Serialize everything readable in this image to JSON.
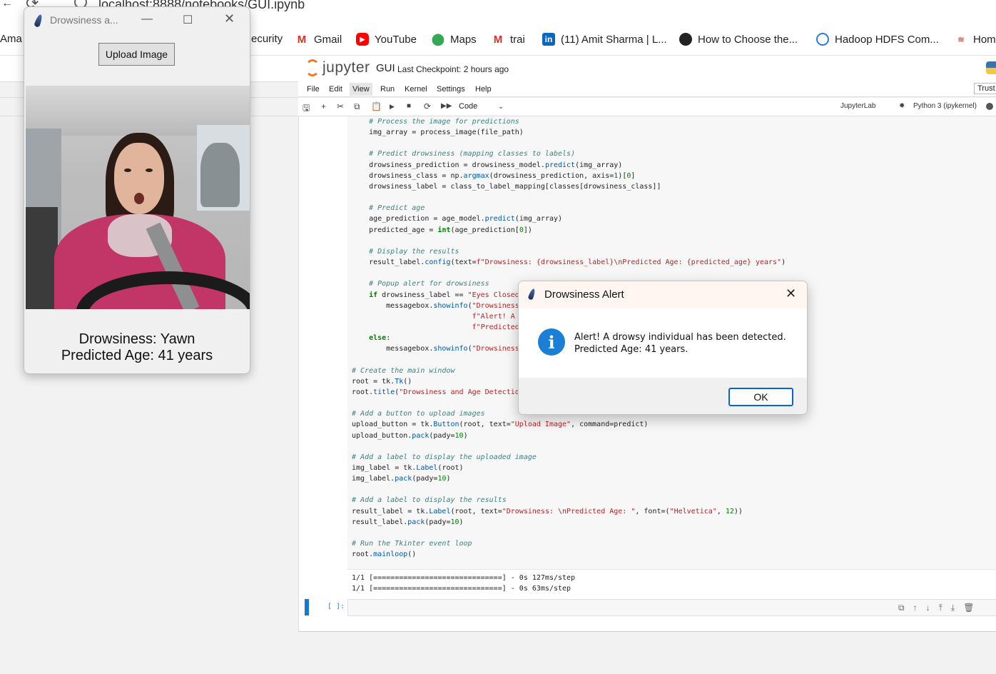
{
  "browser": {
    "url": "localhost:8888/notebooks/GUI.ipynb",
    "bookmarks": [
      {
        "label": "Ama",
        "icon": "amazon-icon"
      },
      {
        "label": "ecurity",
        "icon": "bookmark-icon"
      },
      {
        "label": "Gmail",
        "icon": "gmail-icon"
      },
      {
        "label": "YouTube",
        "icon": "youtube-icon"
      },
      {
        "label": "Maps",
        "icon": "maps-icon"
      },
      {
        "label": "trai",
        "icon": "gmail-icon"
      },
      {
        "label": "(11) Amit Sharma | L...",
        "icon": "linkedin-icon"
      },
      {
        "label": "How to Choose the...",
        "icon": "site-icon"
      },
      {
        "label": "Hadoop HDFS Com...",
        "icon": "site-icon"
      },
      {
        "label": "Hom",
        "icon": "site-icon"
      }
    ]
  },
  "jupyter": {
    "logo": "jupyter",
    "notebook_name": "GUI",
    "checkpoint": "Last Checkpoint: 2 hours ago",
    "trust": "Trust",
    "menu": [
      "File",
      "Edit",
      "View",
      "Run",
      "Kernel",
      "Settings",
      "Help"
    ],
    "active_menu": "View",
    "cell_type": "Code",
    "jupyterlab": "JupyterLab",
    "kernel": "Python 3 (ipykernel)",
    "prompt": "[ ]:",
    "output": [
      "1/1 [==============================] - 0s 127ms/step",
      "1/1 [==============================] - 0s 63ms/step"
    ]
  },
  "tk_window": {
    "title": "Drowsiness a...",
    "upload_button": "Upload Image",
    "result_line1": "Drowsiness: Yawn",
    "result_line2": "Predicted Age: 41 years"
  },
  "alert": {
    "title": "Drowsiness Alert",
    "line1": "Alert! A drowsy individual has been detected.",
    "line2": "Predicted Age: 41 years.",
    "ok": "OK"
  },
  "colors": {
    "accent": "#1976d2",
    "jupyter_orange": "#f37726",
    "info_blue": "#1a7fd5"
  }
}
